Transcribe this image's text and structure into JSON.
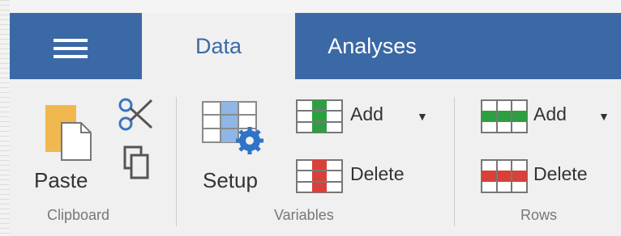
{
  "tabs": [
    {
      "label": "Data",
      "active": true
    },
    {
      "label": "Analyses",
      "active": false
    }
  ],
  "groups": {
    "clipboard": {
      "title": "Clipboard",
      "paste_label": "Paste"
    },
    "variables": {
      "title": "Variables",
      "setup_label": "Setup",
      "add_label": "Add",
      "delete_label": "Delete"
    },
    "rows": {
      "title": "Rows",
      "add_label": "Add",
      "delete_label": "Delete"
    }
  },
  "icons": {
    "menu": "hamburger-icon",
    "paste": "paste-icon",
    "cut": "scissors-icon",
    "copy": "copy-icon",
    "setup": "setup-gear-icon",
    "variables_add": "add-column-icon",
    "variables_delete": "delete-column-icon",
    "rows_add": "add-row-icon",
    "rows_delete": "delete-row-icon",
    "dropdown": "caret-down-icon"
  },
  "colors": {
    "ribbon_blue": "#3b69a6",
    "panel_bg": "#f0f0f0",
    "add_green": "#2e9e43",
    "delete_red": "#d9403a",
    "selection_blue": "#8fb6e6",
    "gear_blue": "#2e73c7",
    "paste_orange": "#f0b84e"
  }
}
